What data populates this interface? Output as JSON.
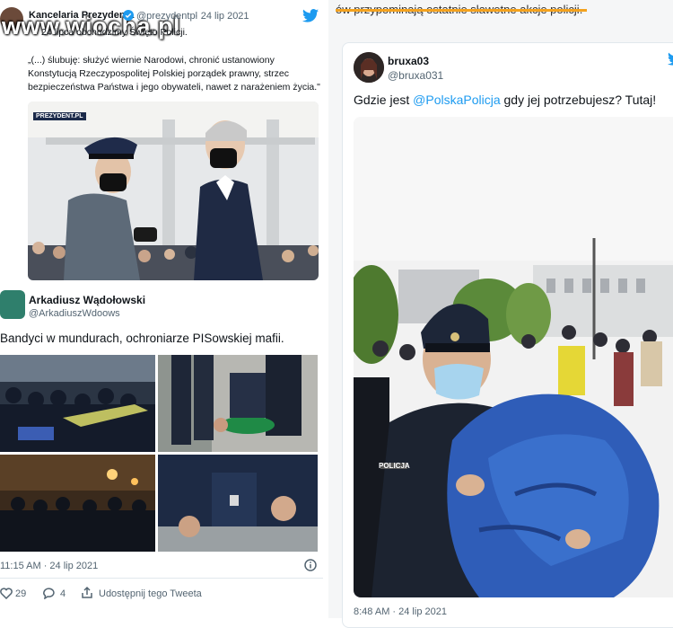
{
  "watermark": "www.wiocha.pl",
  "top_right_text": "ów przypominają ostatnie sławetne akcje policji.",
  "tweet1": {
    "name": "Kancelaria Prezydenta",
    "handle": "@prezydentpl",
    "date": "· 24 lip 2021",
    "line1": "24 lipca obchodzimy Święto Policji.",
    "quote": "„(...) ślubuję: służyć wiernie Narodowi, chronić ustanowiony Konstytucją Rzeczypospolitej Polskiej porządek prawny, strzec bezpieczeństwa Państwa i jego obywateli, nawet z narażeniem życia.\"",
    "photo_tag": "PREZYDENT.PL"
  },
  "tweet2": {
    "name": "Arkadiusz Wądołowski",
    "handle": "@ArkadiuszWdoows",
    "text": "Bandyci w mundurach, ochroniarze PISowskiej mafii.",
    "time": "11:15 AM · 24 lip 2021",
    "likes": "29",
    "replies": "4",
    "share": "Udostępnij tego Tweeta"
  },
  "tweet3": {
    "name": "bruxa03",
    "handle": "@bruxa031",
    "text_before": "Gdzie jest ",
    "mention": "@PolskaPolicja",
    "text_after": " gdy jej potrzebujesz? Tutaj!",
    "time": "8:48 AM · 24 lip 2021",
    "badge": "POLICJA"
  },
  "colors": {
    "twitter_blue": "#1d9bf0",
    "mention": "#1d9bf0",
    "orange": "#f4a21e"
  }
}
